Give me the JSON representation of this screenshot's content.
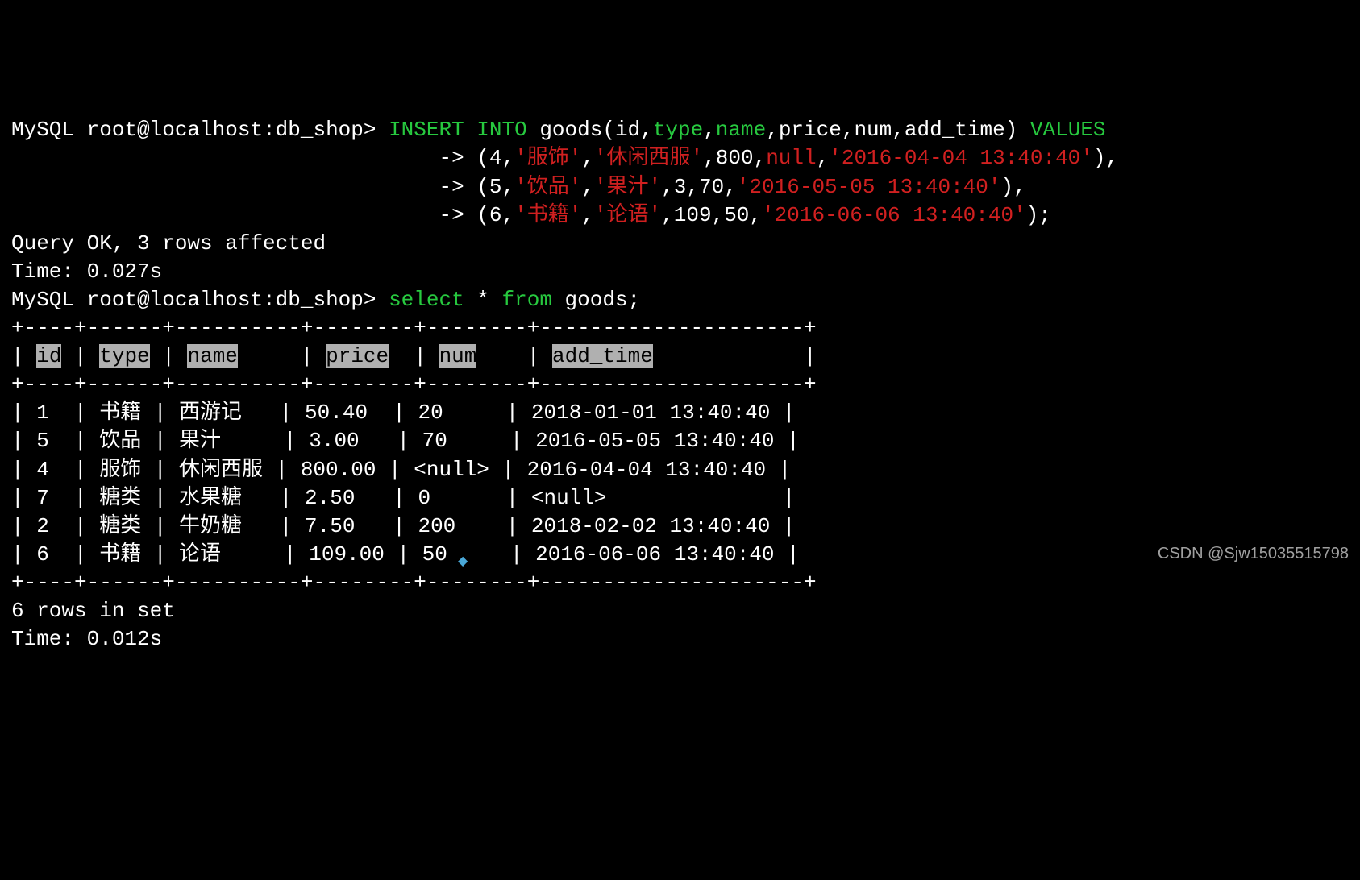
{
  "prompt1_prefix": "MySQL root@localhost:db_shop> ",
  "sql_insert_kw": "INSERT INTO",
  "sql_table": " goods(",
  "sql_col_id": "id",
  "sql_col_type": "type",
  "sql_col_name": "name",
  "sql_col_price": "price",
  "sql_col_num": "num",
  "sql_col_addtime": "add_time",
  "sql_close_paren": ") ",
  "sql_values_kw": "VALUES",
  "cont_prefix": "                                  -> ",
  "row1_open": "(",
  "row1_v1": "4",
  "row1_c1": ",",
  "row1_v2": "'服饰'",
  "row1_c2": ",",
  "row1_v3": "'休闲西服'",
  "row1_c3": ",",
  "row1_v4": "800",
  "row1_c4": ",",
  "row1_v5": "null",
  "row1_c5": ",",
  "row1_v6": "'2016-04-04 13:40:40'",
  "row1_close": "),",
  "row2_open": "(",
  "row2_v1": "5",
  "row2_c1": ",",
  "row2_v2": "'饮品'",
  "row2_c2": ",",
  "row2_v3": "'果汁'",
  "row2_c3": ",",
  "row2_v4": "3",
  "row2_c4": ",",
  "row2_v5": "70",
  "row2_c5": ",",
  "row2_v6": "'2016-05-05 13:40:40'",
  "row2_close": "),",
  "row3_open": "(",
  "row3_v1": "6",
  "row3_c1": ",",
  "row3_v2": "'书籍'",
  "row3_c2": ",",
  "row3_v3": "'论语'",
  "row3_c3": ",",
  "row3_v4": "109",
  "row3_c4": ",",
  "row3_v5": "50",
  "row3_c5": ",",
  "row3_v6": "'2016-06-06 13:40:40'",
  "row3_close": ");",
  "result1_line1": "Query OK, 3 rows affected",
  "result1_line2": "Time: 0.027s",
  "prompt2_prefix": "MySQL root@localhost:db_shop> ",
  "select_kw": "select",
  "select_star": " * ",
  "from_kw": "from",
  "select_table": " goods;",
  "table_border": "+----+------+----------+--------+--------+---------------------+",
  "th_pipe": "|",
  "th_id": "id",
  "th_type": "type",
  "th_name": "name",
  "th_price": "price",
  "th_num": "num",
  "th_addtime": "add_time",
  "th_sp1": " ",
  "th_sp2": " | ",
  "th_sp3": " | ",
  "th_sp4": "     | ",
  "th_sp5": "  | ",
  "th_sp6": "    | ",
  "th_sp7": "            |",
  "data_row1": "| 1  | 书籍 | 西游记   | 50.40  | 20     | 2018-01-01 13:40:40 |",
  "data_row2": "| 5  | 饮品 | 果汁     | 3.00   | 70     | 2016-05-05 13:40:40 |",
  "data_row3": "| 4  | 服饰 | 休闲西服 | 800.00 | <null> | 2016-04-04 13:40:40 |",
  "data_row4": "| 7  | 糖类 | 水果糖   | 2.50   | 0      | <null>              |",
  "data_row5": "| 2  | 糖类 | 牛奶糖   | 7.50   | 200    | 2018-02-02 13:40:40 |",
  "data_row6": "| 6  | 书籍 | 论语     | 109.00 | 50     | 2016-06-06 13:40:40 |",
  "result2_line1": "6 rows in set",
  "result2_line2": "Time: 0.012s",
  "watermark": "CSDN @Sjw15035515798"
}
